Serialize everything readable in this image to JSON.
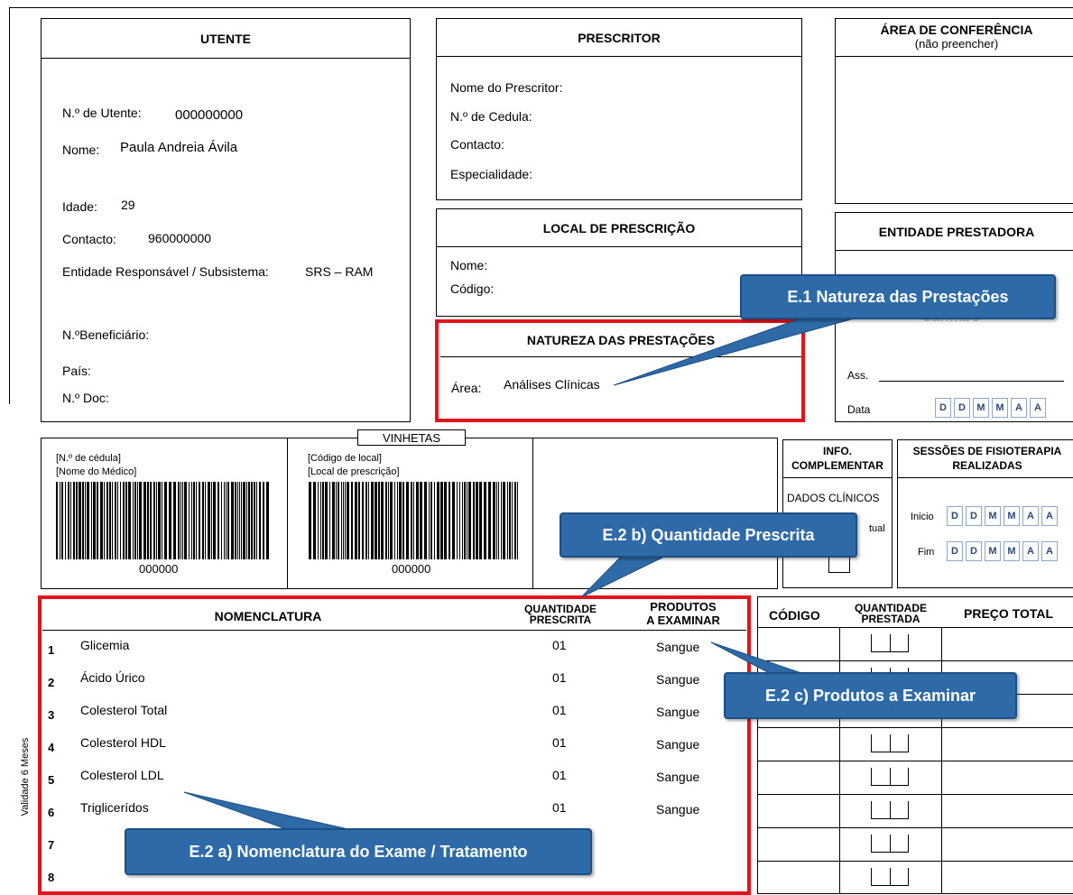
{
  "utente": {
    "header": "UTENTE",
    "n_utente_label": "N.º de Utente:",
    "n_utente_value": "000000000",
    "nome_label": "Nome:",
    "nome_value": "Paula Andreia Ávila",
    "idade_label": "Idade:",
    "idade_value": "29",
    "contacto_label": "Contacto:",
    "contacto_value": "960000000",
    "entidade_label": "Entidade Responsável / Subsistema:",
    "entidade_value": "SRS – RAM",
    "beneficiario_label": "N.ºBeneficiário:",
    "pais_label": "País:",
    "doc_label": "N.º Doc:"
  },
  "prescritor": {
    "header": "PRESCRITOR",
    "nome_label": "Nome do Prescritor:",
    "cedula_label": "N.º de Cedula:",
    "contacto_label": "Contacto:",
    "especialidade_label": "Especialidade:"
  },
  "conferencia": {
    "header": "ÁREA DE CONFERÊNCIA",
    "subheader": "(não preencher)"
  },
  "local": {
    "header": "LOCAL DE PRESCRIÇÃO",
    "nome_label": "Nome:",
    "codigo_label": "Código:"
  },
  "entidade_prestadora": {
    "header": "ENTIDADE PRESTADORA",
    "carimbo": "Carimbo",
    "ass_label": "Ass.",
    "data_label": "Data",
    "date_letters": [
      "D",
      "D",
      "M",
      "M",
      "A",
      "A"
    ]
  },
  "natureza": {
    "header": "NATUREZA DAS PRESTAÇÕES",
    "area_label": "Área:",
    "area_value": "Análises Clínicas"
  },
  "vinhetas": {
    "label": "VINHETAS",
    "left_line1": "[N.º de cédula]",
    "left_line2": "[Nome do Médico]",
    "left_code": "000000",
    "mid_line1": "[Código de local]",
    "mid_line2": "[Local de prescrição]",
    "mid_code": "000000"
  },
  "info": {
    "header_line1": "INFO.",
    "header_line2": "COMPLEMENTAR",
    "dados": "DADOS CLÍNICOS",
    "tual": "tual"
  },
  "sessoes": {
    "header_line1": "SESSÕES DE FISIOTERAPIA",
    "header_line2": "REALIZADAS",
    "inicio_label": "Inicio",
    "fim_label": "Fim"
  },
  "table": {
    "col_nomenclatura": "NOMENCLATURA",
    "col_qtd_line1": "QUANTIDADE",
    "col_qtd_line2": "PRESCRITA",
    "col_prod_line1": "PRODUTOS",
    "col_prod_line2": "A EXAMINAR",
    "rows": [
      {
        "n": "1",
        "nome": "Glicemia",
        "qtd": "01",
        "prod": "Sangue"
      },
      {
        "n": "2",
        "nome": "Ácido Úrico",
        "qtd": "01",
        "prod": "Sangue"
      },
      {
        "n": "3",
        "nome": "Colesterol Total",
        "qtd": "01",
        "prod": "Sangue"
      },
      {
        "n": "4",
        "nome": "Colesterol HDL",
        "qtd": "01",
        "prod": "Sangue"
      },
      {
        "n": "5",
        "nome": "Colesterol LDL",
        "qtd": "01",
        "prod": "Sangue"
      },
      {
        "n": "6",
        "nome": "Triglicerídos",
        "qtd": "01",
        "prod": "Sangue"
      },
      {
        "n": "7",
        "nome": "",
        "qtd": "",
        "prod": ""
      },
      {
        "n": "8",
        "nome": "",
        "qtd": "",
        "prod": ""
      }
    ]
  },
  "right_table": {
    "col_codigo": "CÓDIGO",
    "col_qtd_line1": "QUANTIDADE",
    "col_qtd_line2": "PRESTADA",
    "col_preco": "PREÇO TOTAL"
  },
  "validade": "Validade 6 Meses",
  "callouts": {
    "e1": "E.1 Natureza das Prestações",
    "e2b": "E.2 b) Quantidade Prescrita",
    "e2c": "E.2 c) Produtos a Examinar",
    "e2a": "E.2 a) Nomenclatura do Exame / Tratamento"
  },
  "colors": {
    "callout": "#2f6aa8",
    "highlight": "#e3141b"
  }
}
